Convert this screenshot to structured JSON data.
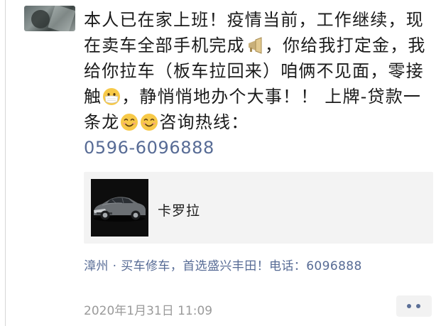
{
  "post": {
    "line1": "本人已在家上班！疫情当前，工作继",
    "line2a": "续，现在卖车全部手机完成",
    "line2b": "，你给我",
    "line3": "打定金，我给你拉车（板车拉回来）咱",
    "line4a": "俩不见面，零接触",
    "line4b": "，静悄悄地办个大",
    "line5a": "事！！ 上牌-贷款一条龙",
    "line5b": "咨询热线：",
    "phone": "0596-6096888",
    "emojis": [
      "megaphone-emoji",
      "medical-mask-emoji",
      "smiling-face-emoji",
      "smiling-face-emoji"
    ]
  },
  "link_card": {
    "title": "卡罗拉",
    "thumbnail": "car-photo"
  },
  "source": {
    "text": "漳州 · 买车修车，首选盛兴丰田！电话：6096888"
  },
  "meta": {
    "timestamp": "2020年1月31日 11:09",
    "more_icon": "more-dots-icon"
  },
  "colors": {
    "link": "#576b95",
    "timestamp": "#9a9a9a",
    "card_bg": "#f3f3f3"
  }
}
